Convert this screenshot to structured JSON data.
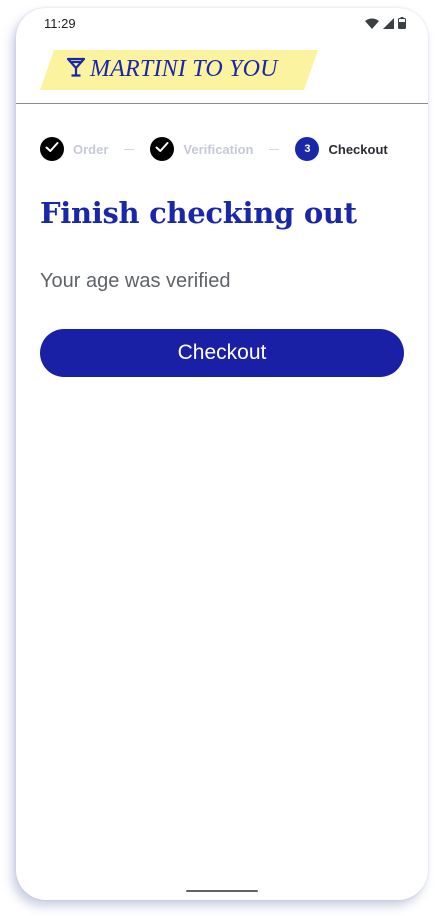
{
  "status_bar": {
    "time": "11:29",
    "icons": [
      "wifi-icon",
      "cellular-signal-icon",
      "battery-icon"
    ]
  },
  "header": {
    "logo_text": "MARTINI TO YOU",
    "logo_icon": "martini-glass-icon",
    "logo_bg_color": "#fbf3a0",
    "brand_color": "#1a27a8"
  },
  "stepper": {
    "steps": [
      {
        "label": "Order",
        "state": "completed",
        "marker": ""
      },
      {
        "label": "Verification",
        "state": "completed",
        "marker": ""
      },
      {
        "label": "Checkout",
        "state": "current",
        "marker": "3"
      }
    ]
  },
  "main": {
    "title": "Finish checking out",
    "message": "Your age was verified",
    "checkout_button_label": "Checkout"
  }
}
